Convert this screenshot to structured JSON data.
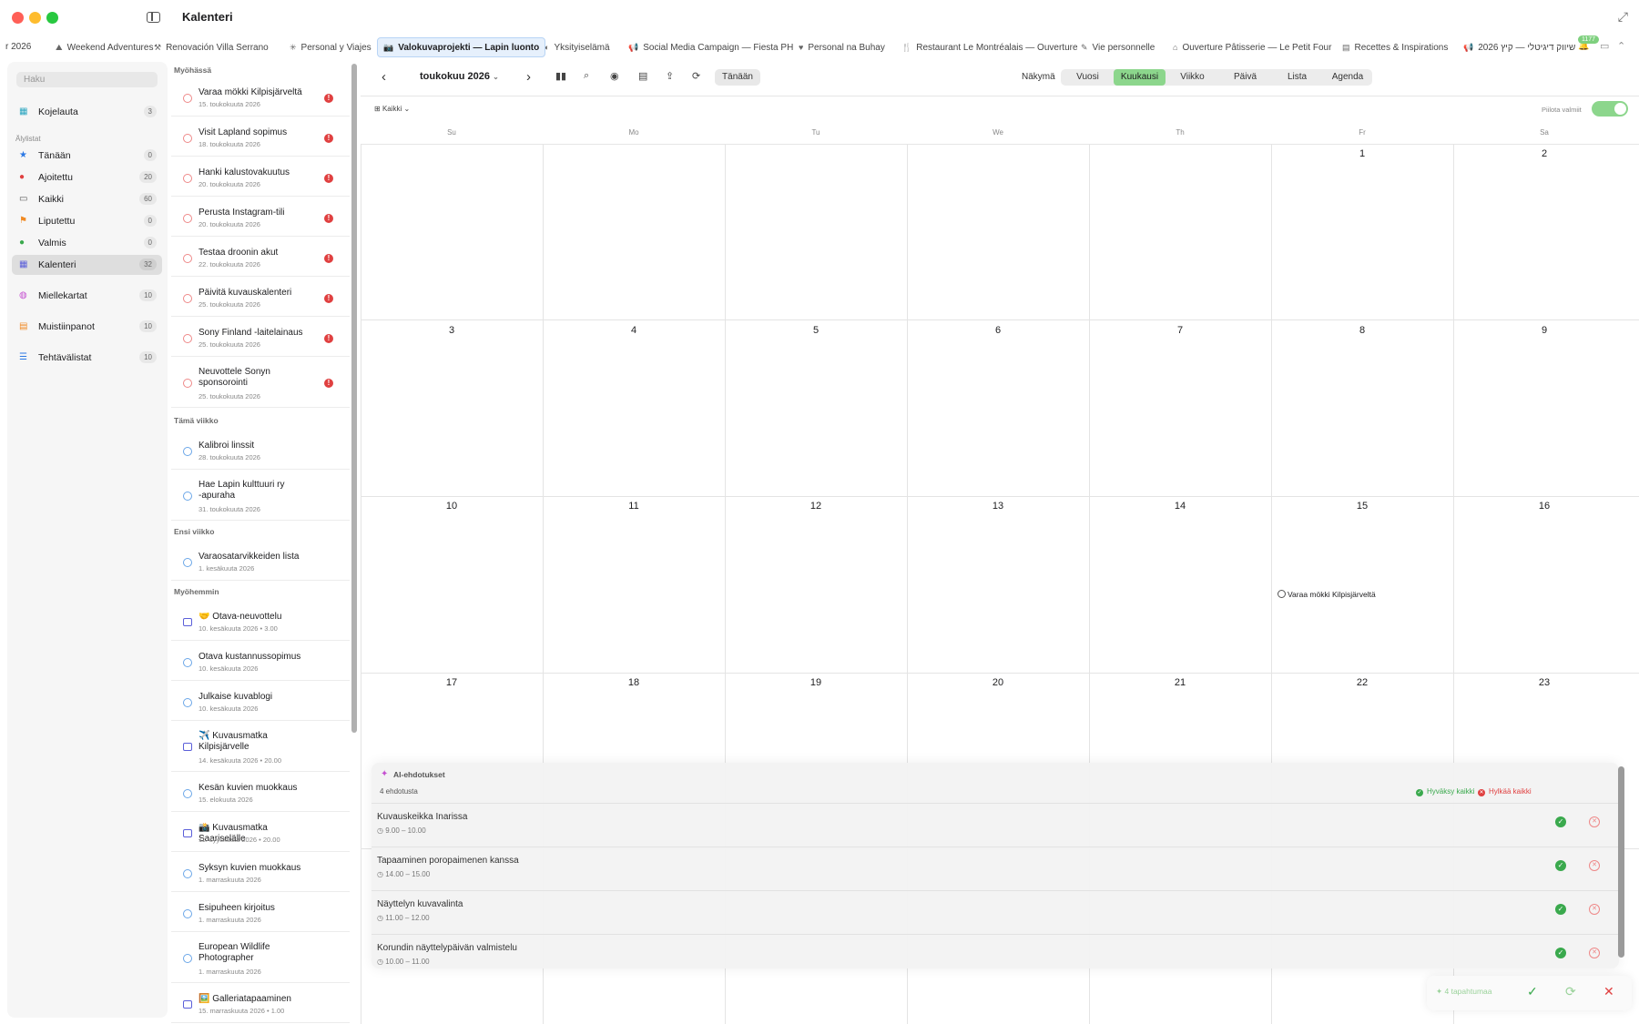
{
  "window": {
    "title": "Kalenteri"
  },
  "tabs": [
    {
      "label": "r 2026",
      "icon": ""
    },
    {
      "label": "Weekend Adventures",
      "icon": "⛰"
    },
    {
      "label": "Renovación Villa Serrano",
      "icon": "⚒"
    },
    {
      "label": "Personal y Viajes",
      "icon": "✳"
    },
    {
      "label": "Valokuvaprojekti — Lapin luonto",
      "icon": "📷"
    },
    {
      "label": "Yksityiselämä",
      "icon": "◐"
    },
    {
      "label": "Social Media Campaign — Fiesta PH",
      "icon": "📢"
    },
    {
      "label": "Personal na Buhay",
      "icon": "♥"
    },
    {
      "label": "Restaurant Le Montréalais — Ouverture",
      "icon": "🍴"
    },
    {
      "label": "Vie personnelle",
      "icon": "✎"
    },
    {
      "label": "Ouverture Pâtisserie — Le Petit Four",
      "icon": "⌂"
    },
    {
      "label": "Recettes & Inspirations",
      "icon": "▤"
    },
    {
      "label": "שיווק דיגיטלי — קיץ 2026",
      "icon": "📢"
    }
  ],
  "tab_badge": "1177",
  "sidebar": {
    "search_placeholder": "Haku",
    "dashboard": {
      "label": "Kojelauta",
      "count": "3"
    },
    "smart_lists_header": "Älylistat",
    "smart": [
      {
        "label": "Tänään",
        "count": "0",
        "icon": "★",
        "color": "#2b78e4"
      },
      {
        "label": "Ajoitettu",
        "count": "20",
        "icon": "●",
        "color": "#e04040"
      },
      {
        "label": "Kaikki",
        "count": "60",
        "icon": "▭",
        "color": "#555555"
      },
      {
        "label": "Liputettu",
        "count": "0",
        "icon": "⚑",
        "color": "#f08a24"
      },
      {
        "label": "Valmis",
        "count": "0",
        "icon": "●",
        "color": "#3aa94d"
      },
      {
        "label": "Kalenteri",
        "count": "32",
        "icon": "▦",
        "color": "#5b5fd9"
      }
    ],
    "other": [
      {
        "label": "Miellekartat",
        "count": "10",
        "icon": "◍",
        "color": "#c44fd0"
      },
      {
        "label": "Muistiinpanot",
        "count": "10",
        "icon": "▤",
        "color": "#f08a24"
      },
      {
        "label": "Tehtävälistat",
        "count": "10",
        "icon": "☰",
        "color": "#2b78e4"
      }
    ]
  },
  "tasklist": {
    "overdue_header": "Myöhässä",
    "overdue": [
      {
        "title": "Varaa mökki Kilpisjärveltä",
        "date": "15. toukokuuta 2026"
      },
      {
        "title": "Visit Lapland sopimus",
        "date": "18. toukokuuta 2026"
      },
      {
        "title": "Hanki kalustovakuutus",
        "date": "20. toukokuuta 2026"
      },
      {
        "title": "Perusta Instagram-tili",
        "date": "20. toukokuuta 2026"
      },
      {
        "title": "Testaa droonin akut",
        "date": "22. toukokuuta 2026"
      },
      {
        "title": "Päivitä kuvauskalenteri",
        "date": "25. toukokuuta 2026"
      },
      {
        "title": "Sony Finland -laitelainaus",
        "date": "25. toukokuuta 2026"
      },
      {
        "title": "Neuvottele Sonyn sponsorointi",
        "date": "25. toukokuuta 2026"
      }
    ],
    "thisweek_header": "Tämä viikko",
    "thisweek": [
      {
        "title": "Kalibroi linssit",
        "date": "28. toukokuuta 2026"
      },
      {
        "title": "Hae Lapin kulttuuri ry -apuraha",
        "date": "31. toukokuuta 2026"
      }
    ],
    "nextweek_header": "Ensi viikko",
    "nextweek": [
      {
        "title": "Varaosatarvikkeiden lista",
        "date": "1. kesäkuuta 2026"
      }
    ],
    "later_header": "Myöhemmin",
    "later": [
      {
        "title": "🤝 Otava-neuvottelu",
        "date": "10. kesäkuuta 2026 • 3.00",
        "kind": "event"
      },
      {
        "title": "Otava kustannussopimus",
        "date": "10. kesäkuuta 2026",
        "kind": "task"
      },
      {
        "title": "Julkaise kuvablogi",
        "date": "10. kesäkuuta 2026",
        "kind": "task"
      },
      {
        "title": "✈️ Kuvausmatka Kilpisjärvelle",
        "date": "14. kesäkuuta 2026 • 20.00",
        "kind": "event"
      },
      {
        "title": "Kesän kuvien muokkaus",
        "date": "15. elokuuta 2026",
        "kind": "task"
      },
      {
        "title": "📸 Kuvausmatka Saariselälle",
        "date": "11. syyskuuta 2026 • 20.00",
        "kind": "event"
      },
      {
        "title": "Syksyn kuvien muokkaus",
        "date": "1. marraskuuta 2026",
        "kind": "task"
      },
      {
        "title": "Esipuheen kirjoitus",
        "date": "1. marraskuuta 2026",
        "kind": "task"
      },
      {
        "title": "European Wildlife Photographer",
        "date": "1. marraskuuta 2026",
        "kind": "task"
      },
      {
        "title": "🖼️ Galleriatapaaminen",
        "date": "15. marraskuuta 2026 • 1.00",
        "kind": "event"
      }
    ]
  },
  "toolbar": {
    "month": "toukokuu 2026",
    "today": "Tänään",
    "view_label": "Näkymä",
    "views": [
      "Vuosi",
      "Kuukausi",
      "Viikko",
      "Päivä",
      "Lista",
      "Agenda"
    ],
    "active_view": "Kuukausi",
    "filter_label": "Kaikki",
    "hide_done_label": "Piilota valmiit"
  },
  "calendar": {
    "weekdays": [
      "Su",
      "Mo",
      "Tu",
      "We",
      "Th",
      "Fr",
      "Sa"
    ],
    "rows": [
      [
        "",
        "",
        "",
        "",
        "",
        "1",
        "2"
      ],
      [
        "3",
        "4",
        "5",
        "6",
        "7",
        "8",
        "9"
      ],
      [
        "10",
        "11",
        "12",
        "13",
        "14",
        "15",
        "16"
      ],
      [
        "17",
        "18",
        "19",
        "20",
        "21",
        "22",
        "23"
      ]
    ],
    "event_title": "Varaa mökki Kilpisjärveltä"
  },
  "ai": {
    "title": "AI-ehdotukset",
    "count_label": "4 ehdotusta",
    "accept_all": "Hyväksy kaikki",
    "reject_all": "Hylkää kaikki",
    "suggestions": [
      {
        "title": "Kuvauskeikka Inarissa",
        "time": "9.00 – 10.00"
      },
      {
        "title": "Tapaaminen poropaimenen kanssa",
        "time": "14.00 – 15.00"
      },
      {
        "title": "Näyttelyn kuvavalinta",
        "time": "11.00 – 12.00"
      },
      {
        "title": "Korundin näyttelypäivän valmistelu",
        "time": "10.00 – 11.00"
      }
    ]
  },
  "bottom_bar": {
    "label": "4 tapahtumaa"
  }
}
